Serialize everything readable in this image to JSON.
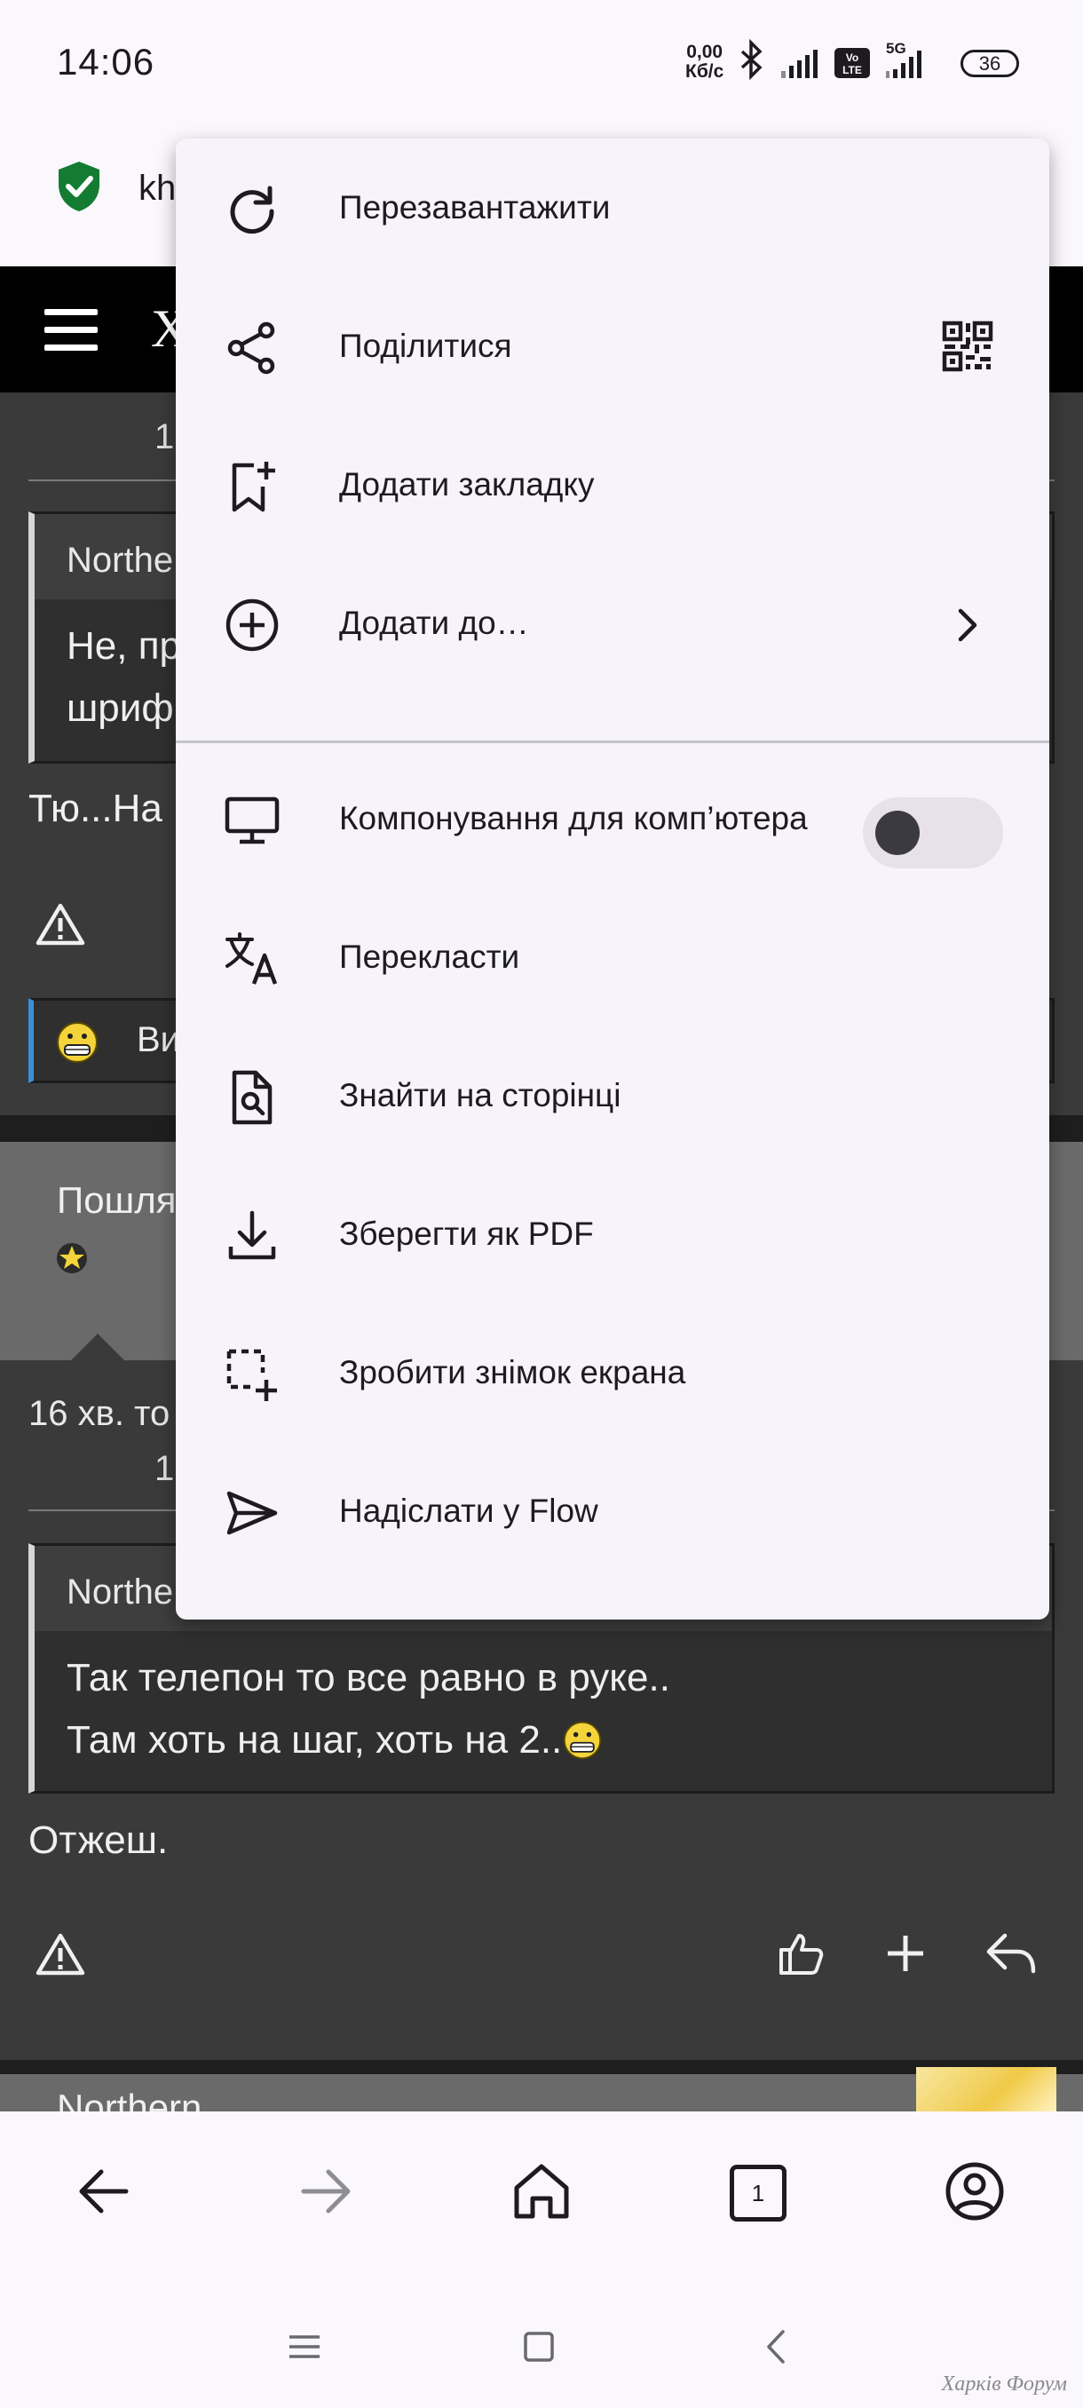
{
  "status_bar": {
    "time": "14:06",
    "speed_value": "0,00",
    "speed_unit": "Кб/с",
    "network_label": "5G",
    "battery": "36"
  },
  "url_bar": {
    "url_fragment": "kh"
  },
  "page": {
    "site_logo": "Х",
    "post1": {
      "number_left": "1",
      "quote_author": "Northe",
      "quote_line1": "Не, пр",
      "quote_line2": "шриф",
      "text": "Тю...На",
      "reaction_text": "Ви"
    },
    "author_panel": {
      "name": "Пошля"
    },
    "post2": {
      "time": "16 хв. то",
      "number_left": "1",
      "quote_author": "Northe",
      "quote_line1": "Так телепон то все равно в руке..",
      "quote_line2": "Там хоть на шаг, хоть на 2..",
      "text": "Отжеш."
    },
    "next_author": "Northern"
  },
  "menu": {
    "items": [
      {
        "label": "Перезавантажити",
        "icon": "reload-icon"
      },
      {
        "label": "Поділитися",
        "icon": "share-icon",
        "trailing": "qr-code-icon"
      },
      {
        "label": "Додати закладку",
        "icon": "bookmark-add-icon"
      },
      {
        "label": "Додати до…",
        "icon": "add-circle-icon",
        "trailing": "chevron-right-icon"
      },
      {
        "label": "Компонування для комп’ютера",
        "icon": "desktop-icon",
        "toggle_on": false
      },
      {
        "label": "Перекласти",
        "icon": "translate-icon"
      },
      {
        "label": "Знайти на сторінці",
        "icon": "find-in-page-icon"
      },
      {
        "label": "Зберегти як PDF",
        "icon": "download-icon"
      },
      {
        "label": "Зробити знімок екрана",
        "icon": "screenshot-icon"
      },
      {
        "label": "Надіслати у Flow",
        "icon": "send-icon"
      }
    ]
  },
  "toolbar": {
    "tab_count": "1"
  },
  "watermark": "Харків Форум"
}
